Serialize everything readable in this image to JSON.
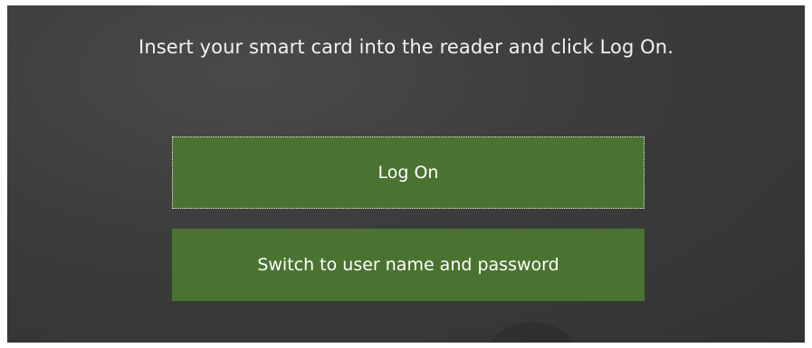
{
  "login": {
    "prompt": "Insert your smart card into the reader and click Log On.",
    "logon_button": "Log On",
    "switch_button": "Switch to user name and password"
  },
  "colors": {
    "background": "#3c3c3c",
    "button": "#4a7331",
    "text": "#ffffff"
  }
}
